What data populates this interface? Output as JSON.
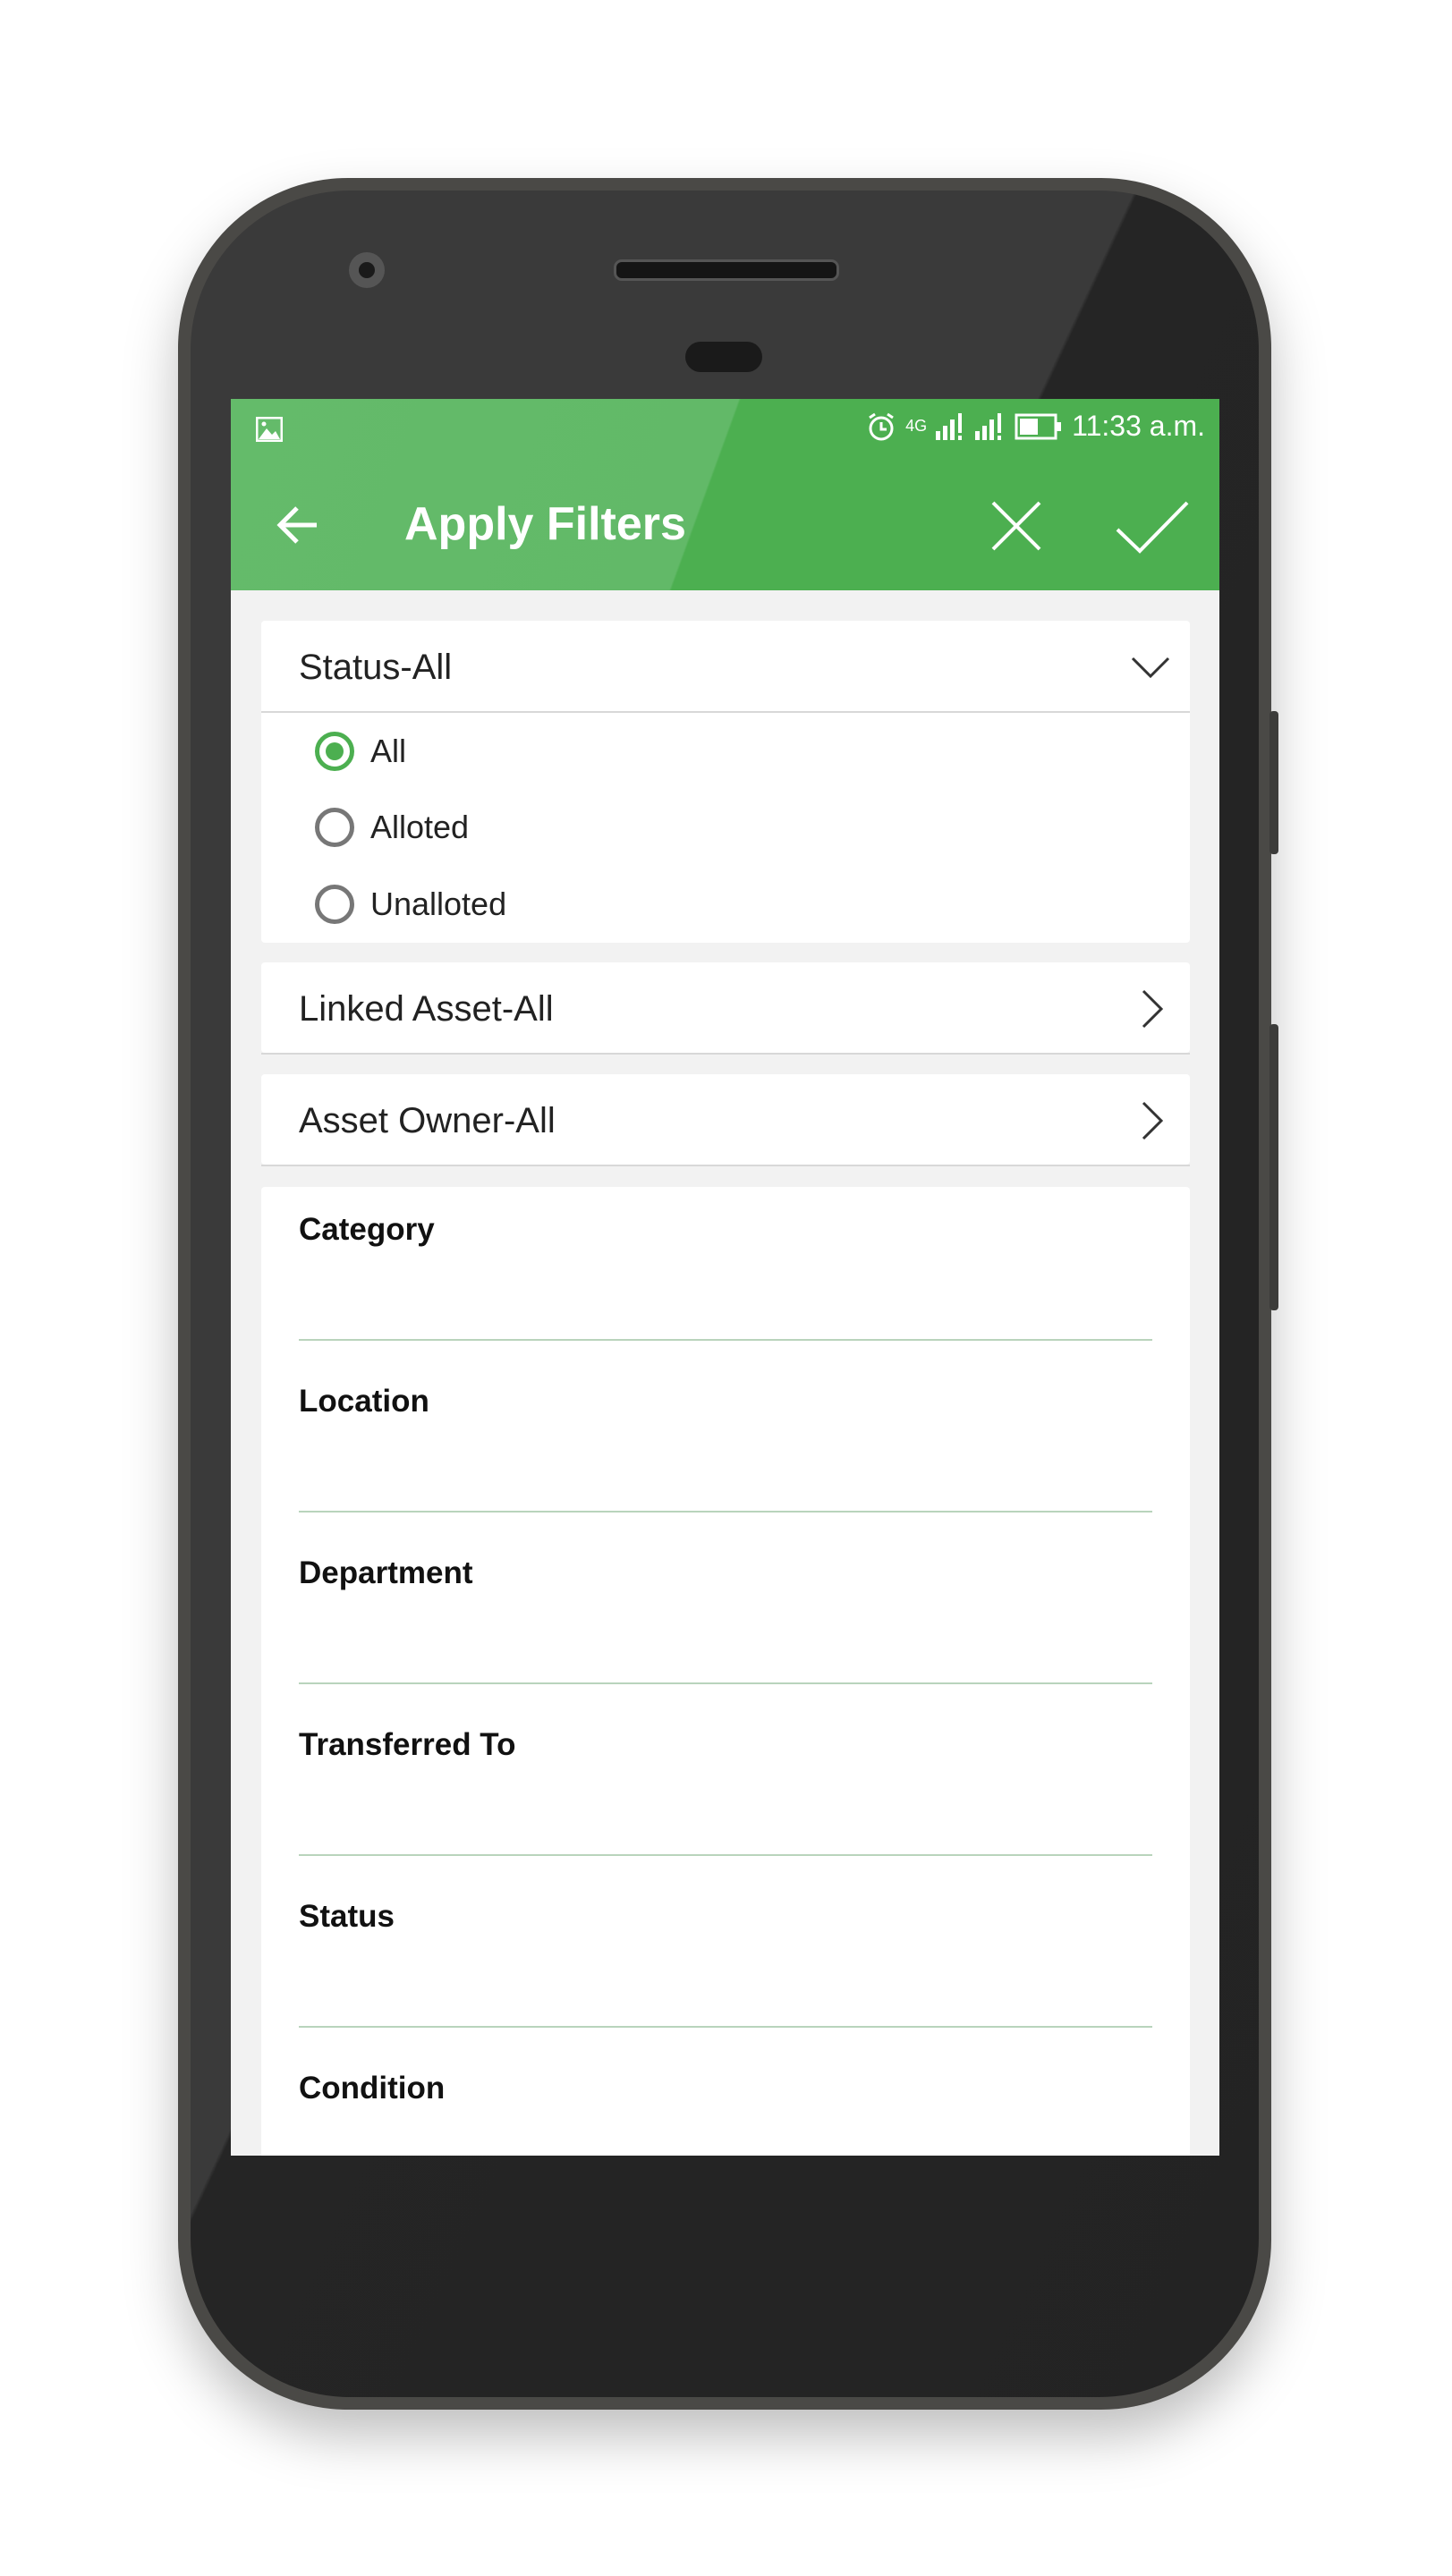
{
  "status_bar": {
    "time": "11:33 a.m.",
    "network": "4G",
    "icons": [
      "image-icon",
      "alarm-icon",
      "signal-icon",
      "signal-icon",
      "battery-icon"
    ]
  },
  "app_bar": {
    "title": "Apply Filters",
    "back_icon": "arrow-left-icon",
    "cancel_icon": "close-icon",
    "apply_icon": "check-icon",
    "color": "#4caf50"
  },
  "status_section": {
    "header": "Status-All",
    "expanded": true,
    "options": [
      {
        "label": "All",
        "selected": true
      },
      {
        "label": "Alloted",
        "selected": false
      },
      {
        "label": "Unalloted",
        "selected": false
      }
    ]
  },
  "linked_asset": {
    "header": "Linked Asset-All"
  },
  "asset_owner": {
    "header": "Asset Owner-All"
  },
  "fields": [
    {
      "label": "Category",
      "value": ""
    },
    {
      "label": "Location",
      "value": ""
    },
    {
      "label": "Department",
      "value": ""
    },
    {
      "label": "Transferred To",
      "value": ""
    },
    {
      "label": "Status",
      "value": ""
    },
    {
      "label": "Condition",
      "value": ""
    }
  ]
}
